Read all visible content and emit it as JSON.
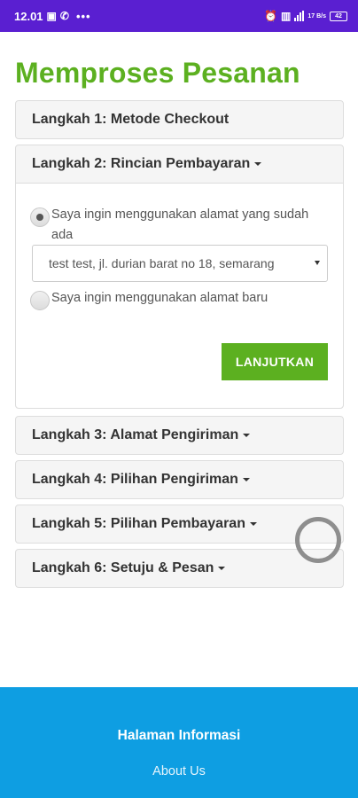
{
  "status_bar": {
    "time": "12.01",
    "left_icons": [
      "image-icon",
      "whatsapp-icon"
    ],
    "dots": "•••",
    "right_icons": [
      "alarm-icon",
      "hd-signal-icon",
      "signal-icon",
      "speed-icon"
    ],
    "speed": "17 B/s",
    "battery": "42"
  },
  "page": {
    "title": "Memproses Pesanan"
  },
  "steps": [
    {
      "label": "Langkah 1: Metode Checkout"
    },
    {
      "label": "Langkah 2: Rincian Pembayaran"
    },
    {
      "label": "Langkah 3: Alamat Pengiriman"
    },
    {
      "label": "Langkah 4: Pilihan Pengiriman"
    },
    {
      "label": "Langkah 5: Pilihan Pembayaran"
    },
    {
      "label": "Langkah 6: Setuju & Pesan"
    }
  ],
  "payment_details": {
    "option_existing": "Saya ingin menggunakan alamat yang sudah ada",
    "address_select": "test test, jl. durian barat no 18, semarang",
    "option_new": "Saya ingin menggunakan alamat baru",
    "selected_option": "existing",
    "continue_label": "LANJUTKAN"
  },
  "footer": {
    "title": "Halaman Informasi",
    "link": "About Us"
  },
  "colors": {
    "status_bar": "#5a1fd1",
    "accent_green": "#5cb020",
    "footer_blue": "#0e9ee2"
  }
}
